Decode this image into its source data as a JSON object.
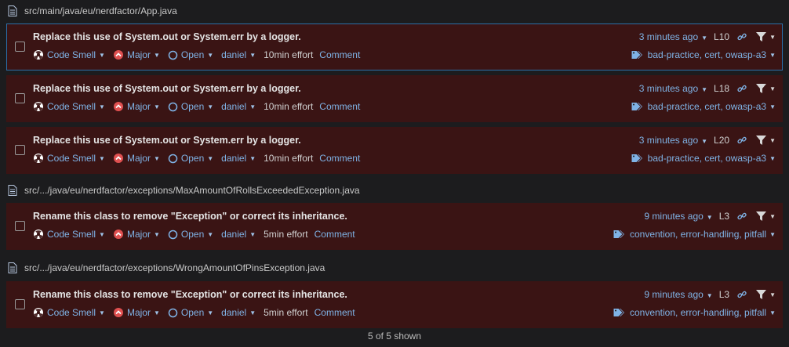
{
  "files": [
    "src/main/java/eu/nerdfactor/App.java",
    "src/.../java/eu/nerdfactor/exceptions/MaxAmountOfRollsExceededException.java",
    "src/.../java/eu/nerdfactor/exceptions/WrongAmountOfPinsException.java"
  ],
  "issues": [
    {
      "message": "Replace this use of System.out or System.err by a logger.",
      "type": "Code Smell",
      "severity": "Major",
      "status": "Open",
      "assignee": "daniel",
      "effort": "10min effort",
      "comment": "Comment",
      "age": "3 minutes ago",
      "line": "L10",
      "tags": "bad-practice, cert, owasp-a3"
    },
    {
      "message": "Replace this use of System.out or System.err by a logger.",
      "type": "Code Smell",
      "severity": "Major",
      "status": "Open",
      "assignee": "daniel",
      "effort": "10min effort",
      "comment": "Comment",
      "age": "3 minutes ago",
      "line": "L18",
      "tags": "bad-practice, cert, owasp-a3"
    },
    {
      "message": "Replace this use of System.out or System.err by a logger.",
      "type": "Code Smell",
      "severity": "Major",
      "status": "Open",
      "assignee": "daniel",
      "effort": "10min effort",
      "comment": "Comment",
      "age": "3 minutes ago",
      "line": "L20",
      "tags": "bad-practice, cert, owasp-a3"
    },
    {
      "message": "Rename this class to remove \"Exception\" or correct its inheritance.",
      "type": "Code Smell",
      "severity": "Major",
      "status": "Open",
      "assignee": "daniel",
      "effort": "5min effort",
      "comment": "Comment",
      "age": "9 minutes ago",
      "line": "L3",
      "tags": "convention, error-handling, pitfall"
    },
    {
      "message": "Rename this class to remove \"Exception\" or correct its inheritance.",
      "type": "Code Smell",
      "severity": "Major",
      "status": "Open",
      "assignee": "daniel",
      "effort": "5min effort",
      "comment": "Comment",
      "age": "9 minutes ago",
      "line": "L3",
      "tags": "convention, error-handling, pitfall"
    }
  ],
  "footer": "5 of 5 shown",
  "colors": {
    "issue_bg": "#3a1414",
    "link": "#7fb3e6",
    "selected_border": "#2d6fa8",
    "severity": "#e05050"
  }
}
